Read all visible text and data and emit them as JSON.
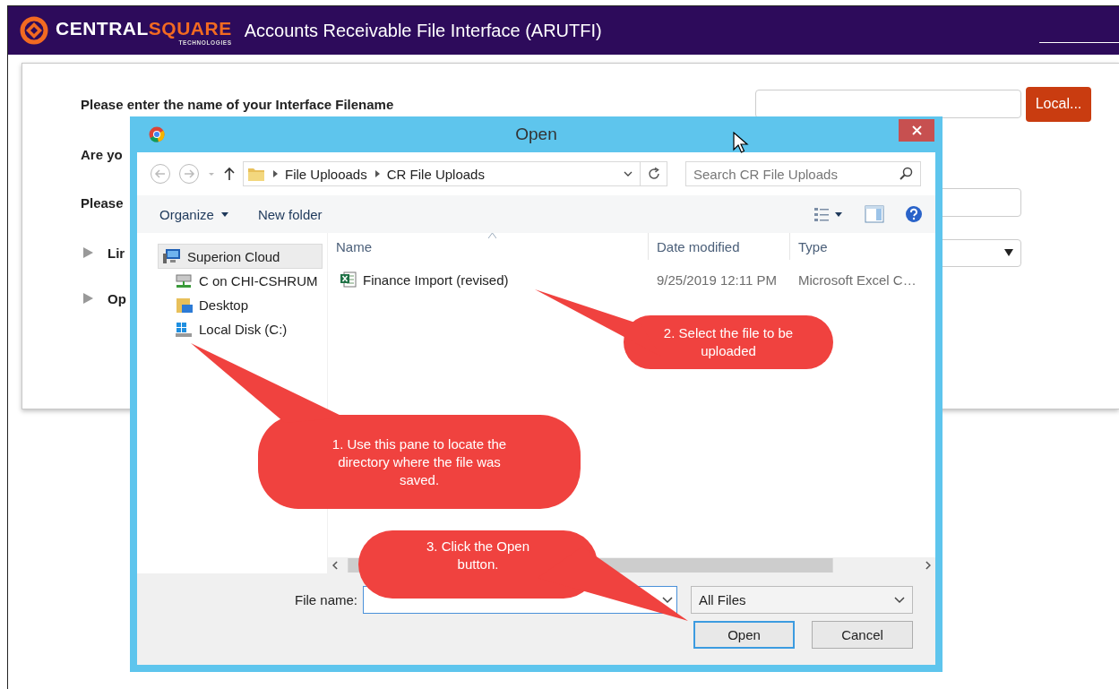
{
  "header": {
    "logo": {
      "word_1": "CENTRAL",
      "word_2": "SQUARE",
      "tagline": "TECHNOLOGIES"
    },
    "title": "Accounts Receivable File Interface (ARUTFI)"
  },
  "form": {
    "rows": [
      {
        "kind": "input",
        "label": "Please enter the name of your Interface Filename",
        "button": "Local..."
      },
      {
        "kind": "text",
        "label": "Are yo"
      },
      {
        "kind": "input",
        "label": "Please"
      },
      {
        "kind": "select",
        "label": "Lir",
        "expanded": false
      },
      {
        "kind": "section",
        "label": "Op",
        "expanded": false
      }
    ]
  },
  "dialog": {
    "title": "Open",
    "path": [
      "File Uplooads",
      "CR File Uploads"
    ],
    "search_placeholder": "Search CR File Uploads",
    "toolbar": {
      "organize": "Organize",
      "new_folder": "New folder"
    },
    "nav": [
      {
        "label": "Superion Cloud",
        "kind": "computer",
        "selected": true,
        "children": [
          {
            "label": "C on CHI-CSHRUM",
            "kind": "network-drive",
            "selected": false
          },
          {
            "label": "Desktop",
            "kind": "desktop",
            "selected": false
          },
          {
            "label": "Local Disk (C:)",
            "kind": "disk",
            "selected": false
          }
        ]
      }
    ],
    "columns": [
      {
        "label": "Name",
        "sorted": true
      },
      {
        "label": "Date modified",
        "sorted": false
      },
      {
        "label": "Type",
        "sorted": false
      }
    ],
    "files": [
      {
        "name": "Finance Import (revised)",
        "date_modified": "9/25/2019 12:11 PM",
        "type": "Microsoft Excel C…",
        "selected": false
      }
    ],
    "file_name_label": "File name:",
    "file_type": "All Files",
    "buttons": [
      {
        "label": "Open",
        "default": true
      },
      {
        "label": "Cancel",
        "default": false
      }
    ]
  },
  "callouts": [
    {
      "text": "1. Use this pane to locate the directory where the file was saved."
    },
    {
      "text": "2. Select the file to be uploaded"
    },
    {
      "text": "3. Click the Open button."
    }
  ]
}
